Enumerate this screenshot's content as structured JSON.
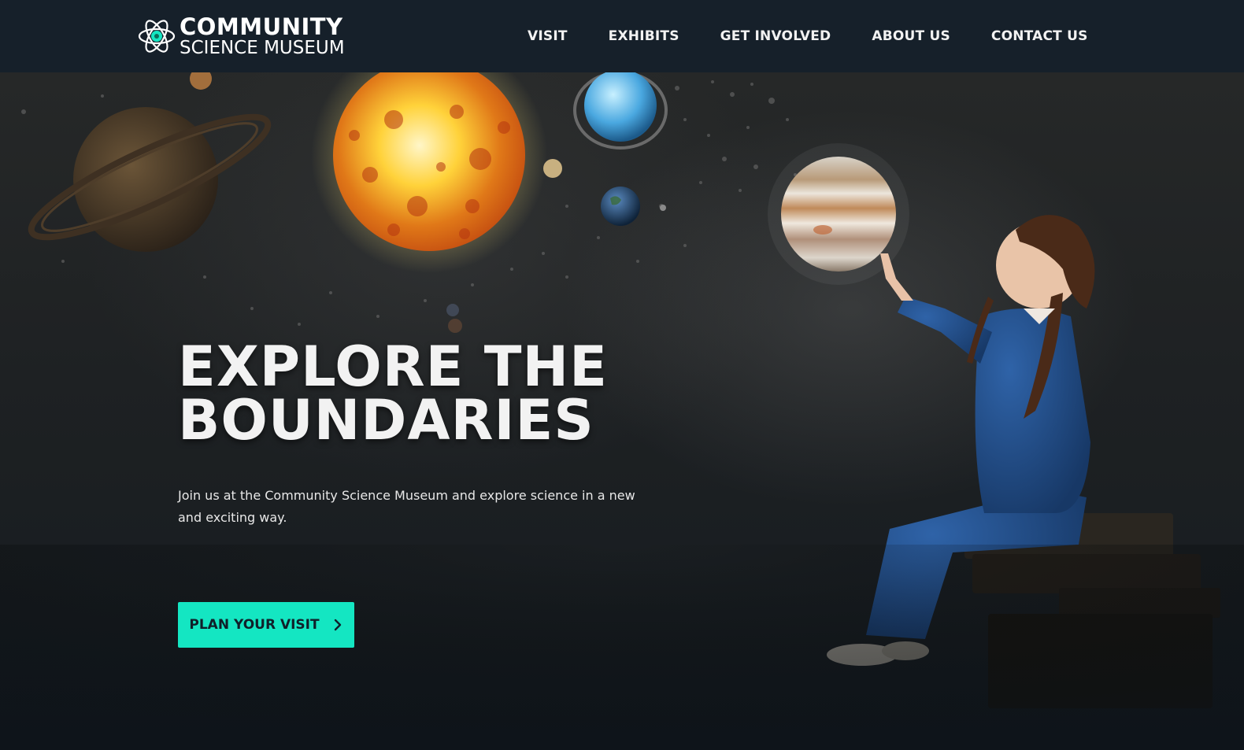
{
  "logo": {
    "line1": "COMMUNITY",
    "line2": "SCIENCE MUSEUM",
    "icon": "atom-icon",
    "accent": "#14e6c2"
  },
  "nav": {
    "items": [
      {
        "label": "VISIT"
      },
      {
        "label": "EXHIBITS"
      },
      {
        "label": "GET INVOLVED"
      },
      {
        "label": "ABOUT US"
      },
      {
        "label": "CONTACT US"
      }
    ]
  },
  "hero": {
    "headline": "EXPLORE THE BOUNDARIES",
    "text": "Join us at the Community Science Museum and explore science in a new and exciting way.",
    "cta": {
      "label": "PLAN YOUR VISIT",
      "icon": "chevron-right-icon",
      "color": "#14e6c2"
    },
    "background_image": "girl-pointing-at-solar-system-photo"
  },
  "colors": {
    "nav_bg": "#16202a",
    "page_bg": "#141a20",
    "accent": "#14e6c2"
  }
}
